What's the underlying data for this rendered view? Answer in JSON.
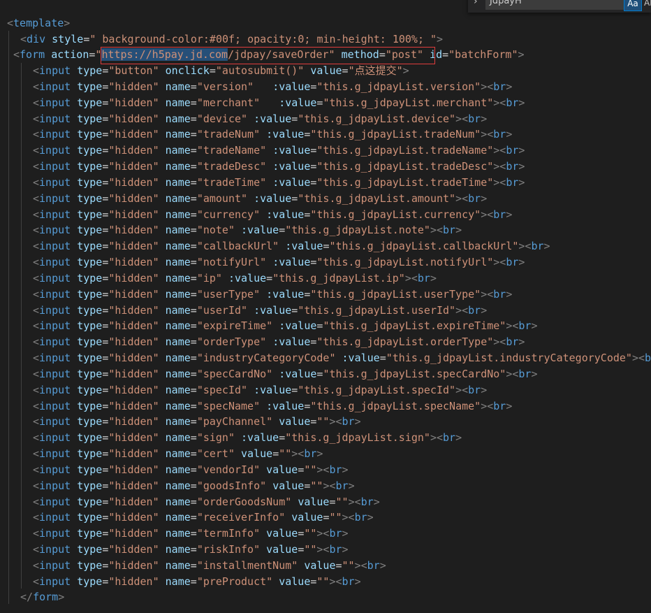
{
  "find_widget": {
    "query": "JdpayH",
    "match_case_label": "Aa",
    "match_word_label": "Ab"
  },
  "colors": {
    "background": "#1e1e1e",
    "tag": "#569cd6",
    "attribute": "#9cdcfe",
    "string": "#ce9178",
    "punctuation": "#808080",
    "highlight_box": "#e03c3c"
  },
  "code": {
    "template_open": "template",
    "div_tag": "div",
    "div_attr": "style",
    "div_value": "\" background-color:#00f; opacity:0; min-height: 100%; \"",
    "form_tag": "form",
    "form_action_attr": "action",
    "form_action_q1": "\"",
    "form_action_url_selected": "https://h5pay.jd.com",
    "form_action_url_rest": "/jdpay/saveOrder\"",
    "form_method_attr": "method",
    "form_method_value": "\"post\"",
    "form_id_attr": "id",
    "form_id_value": "\"batchForm\"",
    "button_line": {
      "tag": "input",
      "type_attr": "type",
      "type_value": "\"button\"",
      "onclick_attr": "onclick",
      "onclick_value": "\"autosubmit()\"",
      "value_attr": "value",
      "value_value": "\"点这提交\""
    },
    "hidden_inputs": [
      {
        "name": "\"version\"",
        "gap": "   ",
        "bind_attr": ":value",
        "bind_value": "\"this.g_jdpayList.version\""
      },
      {
        "name": "\"merchant\"",
        "gap": "   ",
        "bind_attr": ":value",
        "bind_value": "\"this.g_jdpayList.merchant\""
      },
      {
        "name": "\"device\"",
        "gap": " ",
        "bind_attr": ":value",
        "bind_value": "\"this.g_jdpayList.device\""
      },
      {
        "name": "\"tradeNum\"",
        "gap": " ",
        "bind_attr": ":value",
        "bind_value": "\"this.g_jdpayList.tradeNum\""
      },
      {
        "name": "\"tradeName\"",
        "gap": " ",
        "bind_attr": ":value",
        "bind_value": "\"this.g_jdpayList.tradeName\""
      },
      {
        "name": "\"tradeDesc\"",
        "gap": " ",
        "bind_attr": ":value",
        "bind_value": "\"this.g_jdpayList.tradeDesc\""
      },
      {
        "name": "\"tradeTime\"",
        "gap": " ",
        "bind_attr": ":value",
        "bind_value": "\"this.g_jdpayList.tradeTime\""
      },
      {
        "name": "\"amount\"",
        "gap": " ",
        "bind_attr": ":value",
        "bind_value": "\"this.g_jdpayList.amount\""
      },
      {
        "name": "\"currency\"",
        "gap": " ",
        "bind_attr": ":value",
        "bind_value": "\"this.g_jdpayList.currency\""
      },
      {
        "name": "\"note\"",
        "gap": " ",
        "bind_attr": ":value",
        "bind_value": "\"this.g_jdpayList.note\""
      },
      {
        "name": "\"callbackUrl\"",
        "gap": " ",
        "bind_attr": ":value",
        "bind_value": "\"this.g_jdpayList.callbackUrl\""
      },
      {
        "name": "\"notifyUrl\"",
        "gap": " ",
        "bind_attr": ":value",
        "bind_value": "\"this.g_jdpayList.notifyUrl\""
      },
      {
        "name": "\"ip\"",
        "gap": " ",
        "bind_attr": ":value",
        "bind_value": "\"this.g_jdpayList.ip\""
      },
      {
        "name": "\"userType\"",
        "gap": " ",
        "bind_attr": ":value",
        "bind_value": "\"this.g_jdpayList.userType\""
      },
      {
        "name": "\"userId\"",
        "gap": " ",
        "bind_attr": ":value",
        "bind_value": "\"this.g_jdpayList.userId\""
      },
      {
        "name": "\"expireTime\"",
        "gap": " ",
        "bind_attr": ":value",
        "bind_value": "\"this.g_jdpayList.expireTime\""
      },
      {
        "name": "\"orderType\"",
        "gap": " ",
        "bind_attr": ":value",
        "bind_value": "\"this.g_jdpayList.orderType\""
      },
      {
        "name": "\"industryCategoryCode\"",
        "gap": " ",
        "bind_attr": ":value",
        "bind_value": "\"this.g_jdpayList.industryCategoryCode\""
      },
      {
        "name": "\"specCardNo\"",
        "gap": " ",
        "bind_attr": ":value",
        "bind_value": "\"this.g_jdpayList.specCardNo\""
      },
      {
        "name": "\"specId\"",
        "gap": " ",
        "bind_attr": ":value",
        "bind_value": "\"this.g_jdpayList.specId\""
      },
      {
        "name": "\"specName\"",
        "gap": " ",
        "bind_attr": ":value",
        "bind_value": "\"this.g_jdpayList.specName\""
      },
      {
        "name": "\"payChannel\"",
        "gap": " ",
        "bind_attr": "value",
        "bind_value": "\"\""
      },
      {
        "name": "\"sign\"",
        "gap": " ",
        "bind_attr": ":value",
        "bind_value": "\"this.g_jdpayList.sign\""
      },
      {
        "name": "\"cert\"",
        "gap": " ",
        "bind_attr": "value",
        "bind_value": "\"\""
      },
      {
        "name": "\"vendorId\"",
        "gap": " ",
        "bind_attr": "value",
        "bind_value": "\"\""
      },
      {
        "name": "\"goodsInfo\"",
        "gap": " ",
        "bind_attr": "value",
        "bind_value": "\"\""
      },
      {
        "name": "\"orderGoodsNum\"",
        "gap": " ",
        "bind_attr": "value",
        "bind_value": "\"\""
      },
      {
        "name": "\"receiverInfo\"",
        "gap": " ",
        "bind_attr": "value",
        "bind_value": "\"\""
      },
      {
        "name": "\"termInfo\"",
        "gap": " ",
        "bind_attr": "value",
        "bind_value": "\"\""
      },
      {
        "name": "\"riskInfo\"",
        "gap": " ",
        "bind_attr": "value",
        "bind_value": "\"\""
      },
      {
        "name": "\"installmentNum\"",
        "gap": " ",
        "bind_attr": "value",
        "bind_value": "\"\""
      },
      {
        "name": "\"preProduct\"",
        "gap": " ",
        "bind_attr": "value",
        "bind_value": "\"\""
      }
    ],
    "hidden_type_attr": "type",
    "hidden_type_value": "\"hidden\"",
    "name_attr": "name",
    "br_tag": "br",
    "form_close": "form"
  }
}
